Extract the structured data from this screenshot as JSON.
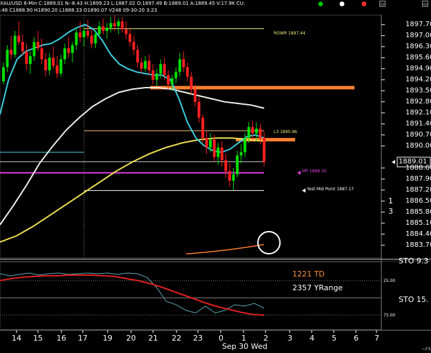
{
  "header": {
    "line1": "XAU/USD 8-Min  C:1889.01  N:-8.43  H:1899.23  L:1887.02  O:1897.49  B:1889.01  A:1889.45  V:17.9K  CU:",
    "line2": ":48  C1888.90  H1890.20  L1888.33  O1890.07  V248  09-30-20  3:23",
    "dots": [
      "●",
      "●",
      "●"
    ],
    "dot_colors": [
      "#00c000",
      "#ffffff",
      "#ff3030"
    ],
    "buttons": [
      "▭",
      "▭"
    ]
  },
  "annotations": {
    "rowr": "ROWR 1897.44",
    "l3": "L3 1890.96",
    "mp": "MP 1888.30",
    "yest_mid": "Yest Mid Point 1887.17",
    "td": "1221 TD",
    "yrange": "2357 YRange",
    "sto_top": "STO 9.3",
    "sto_bottom": "STO 15.",
    "osc_25": "25.00",
    "osc_75": "75.00",
    "fx": "~FX"
  },
  "price_axis": {
    "labels": [
      "1897.70",
      "1897.00",
      "1896.30",
      "1895.60",
      "1894.90",
      "1894.20",
      "1893.50",
      "1892.80",
      "1892.10",
      "1891.40",
      "1890.70",
      "1890.00",
      "1888.60",
      "1887.90",
      "1887.20",
      "1886.50",
      "1885.80",
      "1885.10",
      "1884.40",
      "1883.70"
    ],
    "current": "1889.01",
    "side_marks": [
      "1",
      "3"
    ]
  },
  "time_axis": {
    "labels": [
      "14",
      "15",
      "16",
      "17",
      "19",
      "20",
      "21",
      "22",
      "23",
      "0",
      "1",
      "2",
      "3",
      "4",
      "5",
      "6",
      "7"
    ],
    "date_label": "Sep 30 Wed"
  },
  "colors": {
    "bull": "#00e000",
    "bear": "#ff2020",
    "ma_fast": "#3ad0e0",
    "ma_slow_white": "#f0f0e8",
    "ma_yellow": "#f0e050",
    "orange_level": "#ff8030",
    "magenta_level": "#e040e0",
    "pale_yellow_line": "#f0f080",
    "td_text": "#ff9040",
    "osc_blue": "#60a8b8",
    "osc_red": "#e02020"
  },
  "chart_data": {
    "type": "candlestick",
    "instrument": "XAU/USD",
    "interval": "8-Min",
    "ylim": [
      1882.9,
      1898.3
    ],
    "x_ticks": [
      "14",
      "15",
      "16",
      "17",
      "19",
      "20",
      "21",
      "22",
      "23",
      "0",
      "1",
      "2",
      "3",
      "4",
      "5",
      "6",
      "7"
    ],
    "candles": [
      [
        1894.1,
        1895.3,
        1893.9,
        1895.0
      ],
      [
        1895.0,
        1896.4,
        1894.7,
        1896.1
      ],
      [
        1896.1,
        1897.0,
        1895.5,
        1895.8
      ],
      [
        1895.8,
        1897.3,
        1895.6,
        1897.0
      ],
      [
        1897.0,
        1897.9,
        1896.4,
        1896.6
      ],
      [
        1896.6,
        1897.1,
        1895.8,
        1896.0
      ],
      [
        1896.0,
        1896.5,
        1894.8,
        1895.2
      ],
      [
        1895.2,
        1896.0,
        1894.6,
        1895.7
      ],
      [
        1895.7,
        1896.9,
        1895.4,
        1896.6
      ],
      [
        1896.6,
        1897.3,
        1896.0,
        1896.2
      ],
      [
        1896.2,
        1896.8,
        1895.2,
        1895.5
      ],
      [
        1895.5,
        1895.9,
        1894.4,
        1894.8
      ],
      [
        1894.8,
        1895.9,
        1894.5,
        1895.6
      ],
      [
        1895.6,
        1896.3,
        1894.9,
        1895.1
      ],
      [
        1895.1,
        1895.7,
        1894.3,
        1894.6
      ],
      [
        1894.6,
        1895.8,
        1894.4,
        1895.5
      ],
      [
        1895.5,
        1896.5,
        1895.2,
        1896.2
      ],
      [
        1896.2,
        1896.9,
        1895.6,
        1895.9
      ],
      [
        1895.9,
        1896.6,
        1895.3,
        1896.4
      ],
      [
        1896.4,
        1897.5,
        1896.1,
        1897.2
      ],
      [
        1897.2,
        1897.9,
        1896.6,
        1896.9
      ],
      [
        1896.9,
        1897.6,
        1896.3,
        1897.3
      ],
      [
        1897.3,
        1898.0,
        1896.8,
        1897.0
      ],
      [
        1897.0,
        1897.4,
        1896.2,
        1896.5
      ],
      [
        1896.5,
        1897.3,
        1896.2,
        1897.1
      ],
      [
        1897.1,
        1897.9,
        1896.9,
        1897.6
      ],
      [
        1897.6,
        1898.1,
        1897.1,
        1897.3
      ],
      [
        1897.3,
        1897.8,
        1896.8,
        1897.5
      ],
      [
        1897.5,
        1898.2,
        1897.2,
        1897.8
      ],
      [
        1897.8,
        1898.3,
        1897.3,
        1897.6
      ],
      [
        1897.6,
        1898.1,
        1897.1,
        1897.9
      ],
      [
        1897.9,
        1898.2,
        1897.2,
        1897.4
      ],
      [
        1897.4,
        1897.9,
        1896.8,
        1897.1
      ],
      [
        1897.1,
        1897.5,
        1896.3,
        1896.6
      ],
      [
        1896.6,
        1897.0,
        1895.8,
        1896.1
      ],
      [
        1896.1,
        1896.4,
        1895.0,
        1895.3
      ],
      [
        1895.3,
        1895.6,
        1894.6,
        1894.9
      ],
      [
        1894.9,
        1895.7,
        1894.7,
        1895.4
      ],
      [
        1895.4,
        1895.8,
        1894.5,
        1894.8
      ],
      [
        1894.8,
        1895.2,
        1893.9,
        1894.2
      ],
      [
        1894.2,
        1894.9,
        1893.8,
        1894.6
      ],
      [
        1894.6,
        1895.5,
        1894.3,
        1895.2
      ],
      [
        1895.2,
        1895.6,
        1894.2,
        1894.5
      ],
      [
        1894.5,
        1894.8,
        1893.6,
        1893.9
      ],
      [
        1893.9,
        1894.5,
        1893.5,
        1894.3
      ],
      [
        1894.3,
        1895.0,
        1894.0,
        1894.7
      ],
      [
        1894.7,
        1895.9,
        1894.4,
        1895.5
      ],
      [
        1895.5,
        1896.0,
        1894.7,
        1895.0
      ],
      [
        1895.0,
        1895.3,
        1894.1,
        1894.4
      ],
      [
        1894.4,
        1894.7,
        1893.3,
        1893.6
      ],
      [
        1893.6,
        1893.9,
        1892.5,
        1892.8
      ],
      [
        1892.8,
        1893.1,
        1891.5,
        1891.8
      ],
      [
        1891.8,
        1892.0,
        1890.2,
        1890.5
      ],
      [
        1890.5,
        1890.9,
        1889.5,
        1889.9
      ],
      [
        1889.9,
        1890.8,
        1889.6,
        1890.4
      ],
      [
        1890.4,
        1890.7,
        1889.0,
        1889.3
      ],
      [
        1889.3,
        1890.2,
        1888.8,
        1889.9
      ],
      [
        1889.9,
        1890.3,
        1888.7,
        1889.1
      ],
      [
        1889.1,
        1889.5,
        1888.0,
        1888.4
      ],
      [
        1888.4,
        1888.9,
        1887.4,
        1887.8
      ],
      [
        1887.8,
        1888.6,
        1887.2,
        1888.2
      ],
      [
        1888.2,
        1889.7,
        1888.0,
        1889.4
      ],
      [
        1889.4,
        1890.1,
        1888.9,
        1889.6
      ],
      [
        1889.6,
        1890.8,
        1889.3,
        1890.5
      ],
      [
        1890.5,
        1891.5,
        1890.2,
        1891.2
      ],
      [
        1891.2,
        1891.6,
        1890.4,
        1890.8
      ],
      [
        1890.8,
        1891.5,
        1890.3,
        1891.1
      ],
      [
        1891.1,
        1891.4,
        1890.1,
        1890.5
      ],
      [
        1890.5,
        1890.9,
        1888.7,
        1889.0
      ]
    ],
    "moving_averages": [
      {
        "color": "cyan",
        "values": [
          1892.0,
          1894.2,
          1895.5,
          1896.0,
          1896.2,
          1896.4,
          1896.5,
          1896.8,
          1897.2,
          1897.5,
          1897.7,
          1897.4,
          1896.7,
          1895.8,
          1895.2,
          1894.9,
          1894.7,
          1894.6,
          1894.5,
          1894.5,
          1894.2,
          1893.0,
          1891.5,
          1890.5,
          1890.0,
          1889.7,
          1889.6,
          1889.8,
          1890.2,
          1890.6,
          1890.7,
          1890.5
        ]
      },
      {
        "color": "white",
        "values": [
          1885.0,
          1886.2,
          1887.5,
          1888.9,
          1890.0,
          1891.0,
          1891.8,
          1892.5,
          1893.0,
          1893.4,
          1893.6,
          1893.7,
          1893.7,
          1893.6,
          1893.4,
          1893.2,
          1893.0,
          1892.8,
          1892.7,
          1892.6,
          1892.4
        ]
      },
      {
        "color": "yellow",
        "values": [
          1883.9,
          1884.3,
          1884.9,
          1885.6,
          1886.3,
          1887.0,
          1887.7,
          1888.4,
          1889.0,
          1889.5,
          1889.9,
          1890.2,
          1890.4,
          1890.5,
          1890.5,
          1890.4,
          1890.3
        ]
      }
    ],
    "levels": [
      {
        "name": "ROWR",
        "value": 1897.44
      },
      {
        "name": "L3",
        "value": 1890.96
      },
      {
        "name": "MP",
        "value": 1888.3
      },
      {
        "name": "Yest Mid Point",
        "value": 1887.17
      }
    ],
    "current_price": 1889.01,
    "oscillator": {
      "levels": [
        25,
        75
      ],
      "blue": [
        15,
        18,
        16,
        14,
        17,
        15,
        14,
        16,
        15,
        14,
        15,
        14,
        16,
        14,
        15,
        20,
        35,
        55,
        60,
        68,
        72,
        62,
        72,
        68,
        60,
        62,
        58,
        65
      ],
      "red": [
        25,
        22,
        20,
        19,
        18,
        18,
        17,
        17,
        17,
        18,
        19,
        22,
        25,
        29,
        34,
        40,
        46,
        52,
        58,
        63,
        67,
        71,
        74,
        75
      ]
    }
  }
}
